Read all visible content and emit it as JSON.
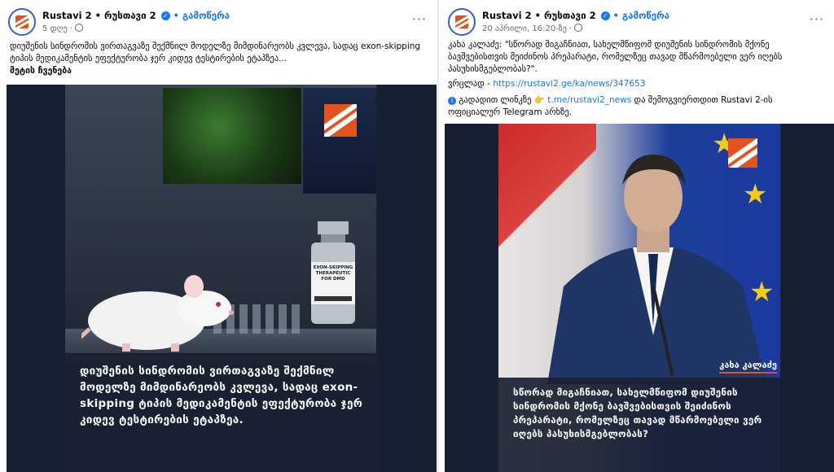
{
  "left_post": {
    "page_name": "Rustavi 2 • რუსთავი 2",
    "follow_label": "• გამოწერა",
    "time": "5 დღე ·",
    "text": "დიუშენის სინდრომის ვირთაგვაზე შექმნილ მოდელზე მიმდინარეობს კვლევა, სადაც exon-skipping ტიპის მედიკამენტის ეფექტურობა ჯერ კიდევ ტესტირების ეტაპზეა...",
    "see_more": "მეტის ჩვენება",
    "vial_label": "EXON-SKIPPING THERAPEUTIC FOR DMD",
    "caption": "დიუშენის სინდრომის ვირთაგვაზე შექმნილ მოდელზე მიმდინარეობს კვლევა, სადაც exon-skipping ტიპის მედიკამენტის ეფექტურობა ჯერ კიდევ ტესტირების ეტაპზეა."
  },
  "right_post": {
    "page_name": "Rustavi 2 • რუსთავი 2",
    "follow_label": "• გამოწერა",
    "time": "20 აპრილი, 16:20-ზე ·",
    "text": "კახა კალაძე: \"სწორად მიგაჩნიათ, სახელმწიფომ დიუშენის სინდრომის მქონე ბავშვებისთვის შეიძინოს პრეპარატი, რომელზეც თავად მწარმოებელი ვერ იღებს პასუხისმგებლობას?\".",
    "detail_label": "ვრცლად -",
    "detail_link": "https://rustavi2.ge/ka/news/347653",
    "telegram_prefix": "გადადით ლინკზე",
    "telegram_link": "t.me/rustavi2_news",
    "telegram_suffix": "და შემოგვიერთდით Rustavi 2-ის ოფიციალურ Telegram არხზე.",
    "name_tag": "კახა კალაძე",
    "caption": "სწორად მიგაჩნიათ, სახელმწიფომ დიუშენის სინდრომის მქონე ბავშვებისთვის შეიძინოს პრეპარატი, რომელზეც თავად მწარმოებელი ვერ იღებს პასუხისმგებლობას?"
  },
  "colors": {
    "accent": "#1877f2",
    "brand": "#e2541f",
    "caption_bg": "#192132"
  },
  "icons": [
    "verified-icon",
    "globe-icon",
    "more-options-icon",
    "info-icon",
    "pointing-hand-icon"
  ]
}
